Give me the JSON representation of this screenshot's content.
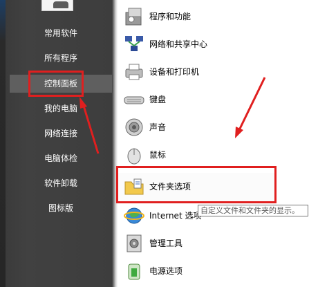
{
  "left_menu": {
    "items": [
      {
        "label": "常用软件"
      },
      {
        "label": "所有程序"
      },
      {
        "label": "控制面板"
      },
      {
        "label": "我的电脑"
      },
      {
        "label": "网络连接"
      },
      {
        "label": "电脑体检"
      },
      {
        "label": "软件卸载"
      },
      {
        "label": "图标版"
      }
    ],
    "highlighted_index": 2
  },
  "control_panel": {
    "items": [
      {
        "label": "程序和功能",
        "icon": "programs-features-icon"
      },
      {
        "label": "网络和共享中心",
        "icon": "network-sharing-icon"
      },
      {
        "label": "设备和打印机",
        "icon": "printer-icon"
      },
      {
        "label": "键盘",
        "icon": "keyboard-icon"
      },
      {
        "label": "声音",
        "icon": "speaker-icon"
      },
      {
        "label": "鼠标",
        "icon": "mouse-icon"
      },
      {
        "label": "文件夹选项",
        "icon": "folder-options-icon"
      },
      {
        "label": "Internet 选项",
        "icon": "internet-icon"
      },
      {
        "label": "管理工具",
        "icon": "admin-tools-icon"
      },
      {
        "label": "电源选项",
        "icon": "power-icon"
      }
    ],
    "highlighted_index": 6
  },
  "tooltip": {
    "text": "自定义文件和文件夹的显示。"
  },
  "colors": {
    "highlight_red": "#e01f1f",
    "menu_background": "#3d3d3d",
    "menu_text": "#ffffff"
  }
}
